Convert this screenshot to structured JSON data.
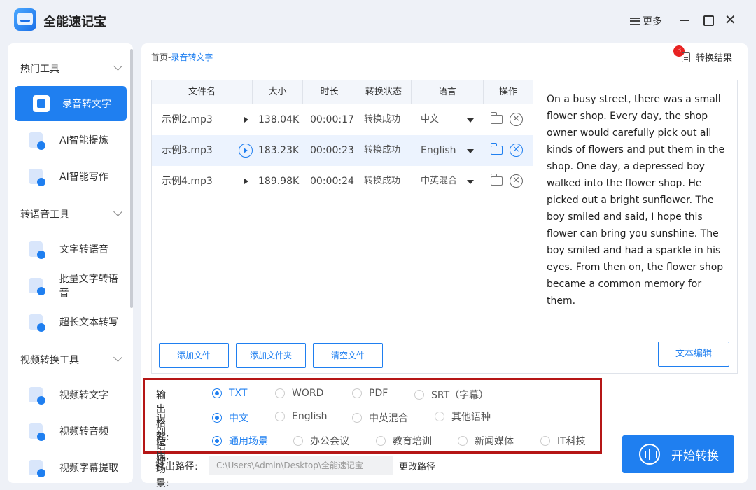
{
  "app": {
    "title": "全能速记宝",
    "more_label": "更多"
  },
  "sidebar": {
    "sections": [
      {
        "title": "热门工具"
      },
      {
        "title": "转语音工具"
      },
      {
        "title": "视频转换工具"
      }
    ],
    "items": [
      {
        "label": "录音转文字"
      },
      {
        "label": "AI智能提炼"
      },
      {
        "label": "AI智能写作"
      },
      {
        "label": "文字转语音"
      },
      {
        "label": "批量文字转语音"
      },
      {
        "label": "超长文本转写"
      },
      {
        "label": "视频转文字"
      },
      {
        "label": "视频转音频"
      },
      {
        "label": "视频字幕提取"
      }
    ]
  },
  "breadcrumb": {
    "home": "首页",
    "sep": "-",
    "current": "录音转文字"
  },
  "result": {
    "badge": "3",
    "label": "转换结果"
  },
  "table": {
    "headers": [
      "文件名",
      "大小",
      "时长",
      "转换状态",
      "语言",
      "操作"
    ],
    "rows": [
      {
        "name": "示例2.mp3",
        "size": "138.04K",
        "duration": "00:00:17",
        "status": "转换成功",
        "lang": "中文"
      },
      {
        "name": "示例3.mp3",
        "size": "183.23K",
        "duration": "00:00:23",
        "status": "转换成功",
        "lang": "English"
      },
      {
        "name": "示例4.mp3",
        "size": "189.98K",
        "duration": "00:00:24",
        "status": "转换成功",
        "lang": "中英混合"
      }
    ]
  },
  "buttons": {
    "add_file": "添加文件",
    "add_folder": "添加文件夹",
    "clear_files": "清空文件",
    "edit_text": "文本编辑",
    "start": "开始转换"
  },
  "transcript": "On a busy street, there was a small flower shop. Every day, the shop owner would carefully pick out all kinds of flowers and put them in the shop. One day, a depressed boy walked into the flower shop. He picked out a bright sunflower. The boy smiled and said, I hope this flower can bring you sunshine. The boy smiled and had a sparkle in his eyes. From then on, the flower shop became a common memory for them.",
  "options": {
    "format": {
      "label": "输出格式:",
      "choices": [
        "TXT",
        "WORD",
        "PDF",
        "SRT（字幕）"
      ],
      "selected": "TXT"
    },
    "language": {
      "label": "识别语种:",
      "choices": [
        "中文",
        "English",
        "中英混合",
        "其他语种"
      ],
      "selected": "中文"
    },
    "scene": {
      "label": "使用场景:",
      "choices": [
        "通用场景",
        "办公会议",
        "教育培训",
        "新闻媒体",
        "IT科技"
      ],
      "selected": "通用场景"
    }
  },
  "output": {
    "label": "输出路径:",
    "path": "C:\\Users\\Admin\\Desktop\\全能速记宝",
    "change": "更改路径"
  },
  "colors": {
    "accent": "#1f7ff0",
    "highlight_border": "#b51616",
    "badge": "#e82222"
  }
}
